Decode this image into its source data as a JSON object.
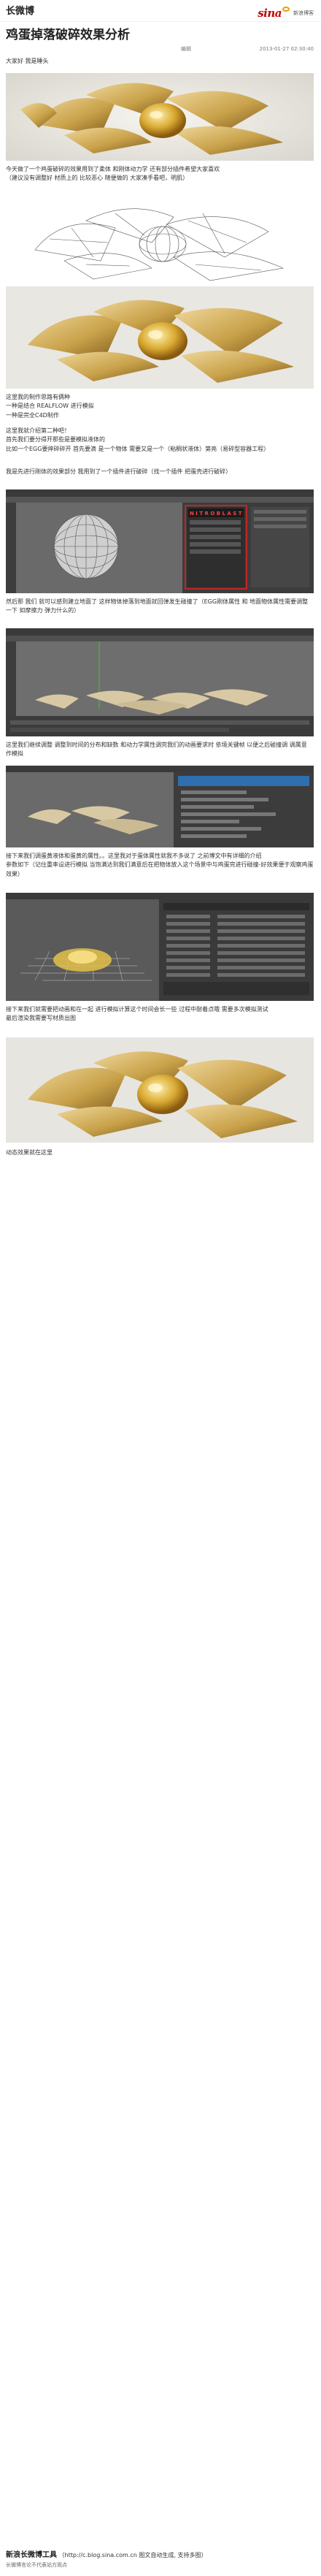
{
  "header": {
    "app_name": "长微博",
    "brand_logo": "sina",
    "brand_sub": "新浪博客"
  },
  "article": {
    "title": "鸡蛋掉落破碎效果分析",
    "author": "编辑",
    "timestamp": "2013-01-27 02:30:40",
    "paragraphs": {
      "p1": "大家好 我是睡头",
      "p2": "今天做了一个鸡蛋破碎的效果用到了柔体 和刚体动力学 还有部分插件希望大家喜欢\n（建议没有调整好 材质上的 比较恶心 随便做的 大家凑手看吧，明肌）",
      "p3": "这里我的制作思路有俩种\n一种是结合 REALFLOW 进行模拟\n一种是完全C4D制作",
      "p4": "这里我就介绍第二种吧！\n首先我们要分得开那些是要模拟液体的\n比如一个EGG要摔碎碎开 首先要滴 是一个物体 需要又是一个（粘稠状液体）第亮（易碎型容器工程）",
      "p5": "我是先进行刚体的效果部分 我用到了一个插件进行破碎（找一个插件 把蛋壳进行破碎）",
      "p6": "然后那 我们 就可以感到建立地面了 这样物体掉落到地面就回弹发生碰撞了（EGG刚体属性 和 地面物体属性需要调整一下 如摩擦力 弹力什么的）",
      "p7": "这里我们继续调整 调整到时间的分布和缺数 和动力学属性调完我们的动画要求时 依境关键帧 以便之后碰撞调 调属意 作模拟",
      "p8": "接下来我们调蛋黄液体和蛋黄的属性。。这里我对于蛋体属性就我不多说了 之前博文中有详细的介绍\n参数如下（记住重率设进行模拟 当饱满达到我们满意后在把物体放入这个场景中与鸡蛋完进行碰撞-好效果便于观察鸡蛋效果）",
      "p9": "接下来我们就需要把动画和在一起 进行模拟计算这个时间会长一些 过程中耐着点哦 需要多次模拟测试\n最后渲染我需要写材质出图",
      "p10": "动态效果就在这里"
    }
  },
  "images": [
    {
      "name": "render-1",
      "kind": "render"
    },
    {
      "name": "wireframe-1",
      "kind": "wireframe"
    },
    {
      "name": "render-2",
      "kind": "render"
    },
    {
      "name": "screenshot-shatter-plugin",
      "kind": "ui"
    },
    {
      "name": "screenshot-ground-collision",
      "kind": "ui"
    },
    {
      "name": "screenshot-dynamics-settings",
      "kind": "ui"
    },
    {
      "name": "screenshot-fluid-settings",
      "kind": "ui"
    },
    {
      "name": "render-final",
      "kind": "render"
    }
  ],
  "plugin_dialog_label": "N I T R O B L A S T",
  "footer": {
    "name": "新浪长微博工具",
    "url": "（http://c.blog.sina.com.cn  图文自动生成, 支持多图）",
    "disclaimer": "长微博言论不代表站方观点"
  },
  "colors": {
    "shell": "#c9a24a",
    "yolk": "#d8a830",
    "ui_bg": "#5a5a5a",
    "highlight_box": "#e02020",
    "timeline_green": "#33cc33"
  }
}
